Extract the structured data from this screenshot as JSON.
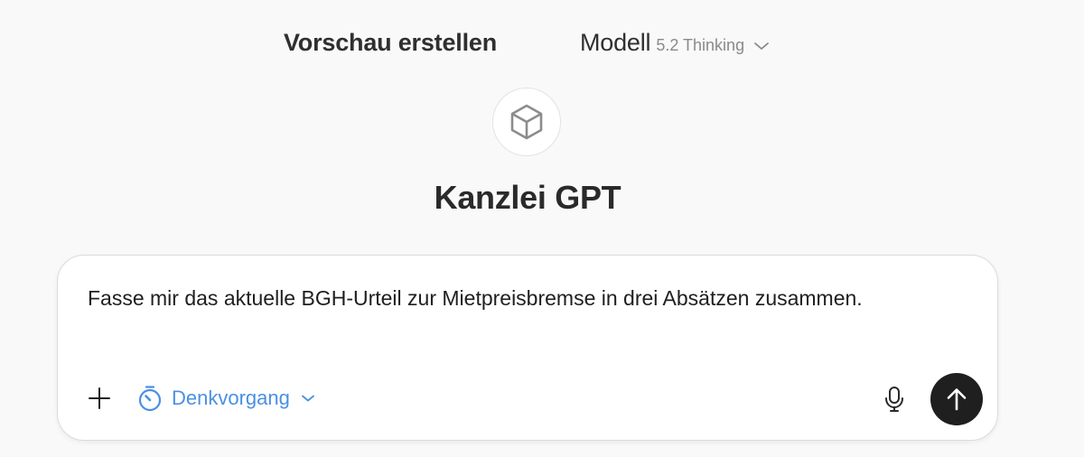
{
  "header": {
    "tab_preview_label": "Vorschau erstellen",
    "model_label": "Modell",
    "model_version": "5.2 Thinking"
  },
  "gpt": {
    "title": "Kanzlei GPT",
    "icon": "cube-icon"
  },
  "composer": {
    "prompt_text": "Fasse mir das aktuelle BGH-Urteil zur Mietpreisbremse in drei Absätzen zusammen.",
    "reasoning_label": "Denkvorgang",
    "icons": {
      "add": "plus-icon",
      "reasoning": "timer-icon",
      "mic": "microphone-icon",
      "send": "arrow-up-icon"
    }
  },
  "colors": {
    "background": "#f9f9f9",
    "accent_blue": "#4a90e2",
    "send_button": "#1f1f1f"
  }
}
